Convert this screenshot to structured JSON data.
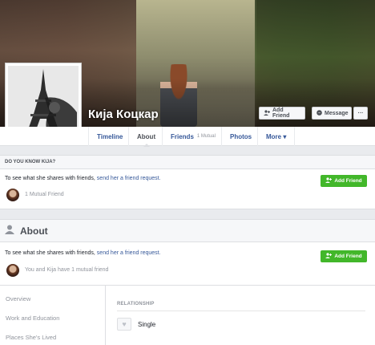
{
  "profile": {
    "name": "Кија Коцкар",
    "add_friend_label": "Add Friend",
    "message_label": "Message",
    "more_dots": "···"
  },
  "nav": {
    "tabs": [
      {
        "label": "Timeline"
      },
      {
        "label": "About"
      },
      {
        "label": "Friends",
        "sub": "1 Mutual"
      },
      {
        "label": "Photos"
      },
      {
        "label": "More ▾"
      }
    ]
  },
  "do_you_know": {
    "heading": "DO YOU KNOW KIJA?",
    "request_prefix": "To see what she shares with friends,",
    "request_link": "send her a friend request.",
    "add_friend_label": "Add Friend",
    "mutual": "1 Mutual Friend"
  },
  "about": {
    "title": "About",
    "request_prefix": "To see what she shares with friends,",
    "request_link": "send her a friend request.",
    "add_friend_label": "Add Friend",
    "mutual": "You and Kija have 1 mutual friend",
    "left_nav": [
      "Overview",
      "Work and Education",
      "Places She's Lived"
    ],
    "relationship_label": "RELATIONSHIP",
    "relationship_value": "Single"
  },
  "colors": {
    "link": "#365899",
    "green": "#42b72a",
    "background": "#e9ebee"
  }
}
